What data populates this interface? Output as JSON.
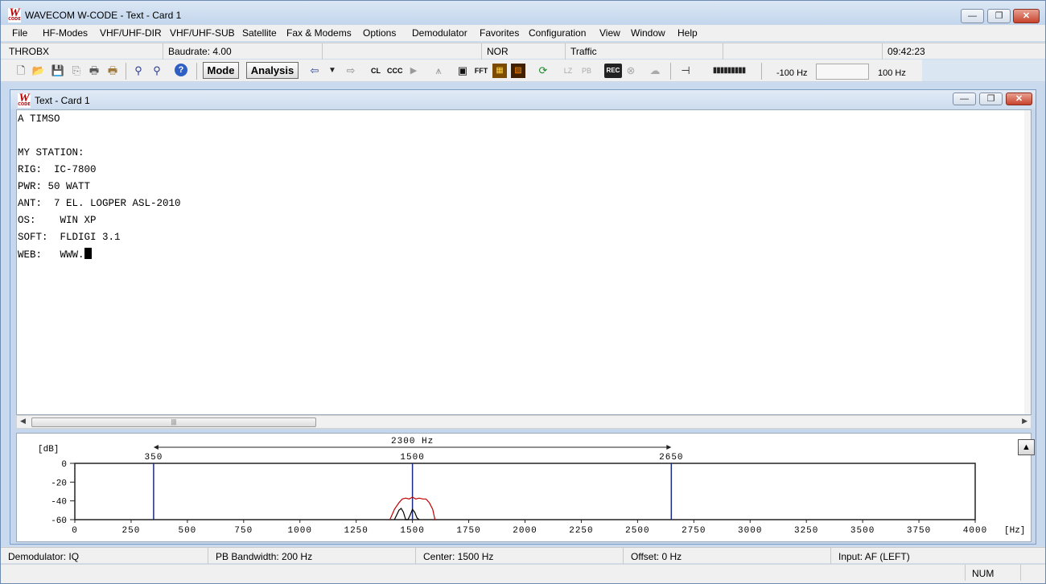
{
  "app": {
    "logo_letter": "W",
    "logo_sub": "CODE",
    "title": "WAVECOM W-CODE - Text  - Card 1",
    "controls": {
      "min": "—",
      "max": "❐",
      "close": "✕"
    }
  },
  "menu": [
    "File",
    "HF-Modes",
    "VHF/UHF-DIR",
    "VHF/UHF-SUB",
    "Satellite",
    "Fax & Modems",
    "Options",
    "Demodulator",
    "Favorites",
    "Configuration",
    "View",
    "Window",
    "Help"
  ],
  "info": {
    "mode": "THROBX",
    "baudrate": "Baudrate: 4.00",
    "cell3": "",
    "polarity": "NOR",
    "traffic": "Traffic",
    "cell6": "",
    "time": "09:42:23"
  },
  "toolbar": {
    "mode_label": "Mode",
    "analysis_label": "Analysis",
    "icons": [
      "new-icon",
      "open-icon",
      "save-icon",
      "copy-icon",
      "print-icon",
      "print-setup-icon",
      "find-icon",
      "find-next-icon",
      "help-icon",
      "arrow-left-icon",
      "dropdown-icon",
      "arrow-right-icon",
      "clear-icon",
      "ccc-icon",
      "play-icon",
      "tune-icon",
      "display-icon",
      "fft-icon",
      "waterfall-icon",
      "sonagram-icon",
      "refresh-icon",
      "lock-icon",
      "pb-icon",
      "rec-icon",
      "mute-icon",
      "cloud-icon",
      "zero-icon",
      "level-meter-icon"
    ],
    "freq_low": "-100 Hz",
    "freq_high": "100 Hz"
  },
  "child": {
    "title": "Text  - Card 1",
    "lines": [
      "A TIMSO",
      "",
      "MY STATION:",
      "RIG:  IC-7800",
      "PWR: 50 WATT",
      "ANT:  7 EL. LOGPER ASL-2010",
      "OS:    WIN XP",
      "SOFT:  FLDIGI 3.1",
      "WEB:   WWW."
    ]
  },
  "spectrum": {
    "span_label": "2300 Hz",
    "marker_low": "350",
    "marker_center": "1500",
    "marker_high": "2650",
    "y_unit": "[dB]",
    "x_unit": "[Hz]",
    "up_button": "▲"
  },
  "chart_data": {
    "type": "line",
    "xlabel": "[Hz]",
    "ylabel": "[dB]",
    "xlim": [
      0,
      4000
    ],
    "ylim": [
      -60,
      0
    ],
    "xticks": [
      0,
      250,
      500,
      750,
      1000,
      1250,
      1500,
      1750,
      2000,
      2250,
      2500,
      2750,
      3000,
      3250,
      3500,
      3750,
      4000
    ],
    "yticks": [
      0,
      -20,
      -40,
      -60
    ],
    "markers": [
      350,
      1500,
      2650
    ],
    "span": [
      350,
      2650
    ],
    "series": [
      {
        "color": "#c00000",
        "x": [
          1400,
          1420,
          1440,
          1455,
          1470,
          1485,
          1500,
          1515,
          1530,
          1545,
          1560,
          1575,
          1590,
          1600
        ],
        "y": [
          -60,
          -49,
          -42,
          -38,
          -37,
          -38,
          -36,
          -38,
          -37,
          -38,
          -38,
          -42,
          -49,
          -60
        ]
      },
      {
        "color": "#000000",
        "x": [
          1420,
          1430,
          1440,
          1450,
          1460,
          1470,
          1480,
          1490,
          1500,
          1510,
          1520,
          1530
        ],
        "y": [
          -60,
          -55,
          -50,
          -48,
          -52,
          -60,
          -60,
          -55,
          -49,
          -52,
          -58,
          -60
        ]
      }
    ]
  },
  "status": {
    "demodulator": "Demodulator: IQ",
    "bandwidth": "PB Bandwidth: 200 Hz",
    "center": "Center: 1500 Hz",
    "offset": "Offset: 0 Hz",
    "input": "Input: AF (LEFT)",
    "num": "NUM"
  }
}
